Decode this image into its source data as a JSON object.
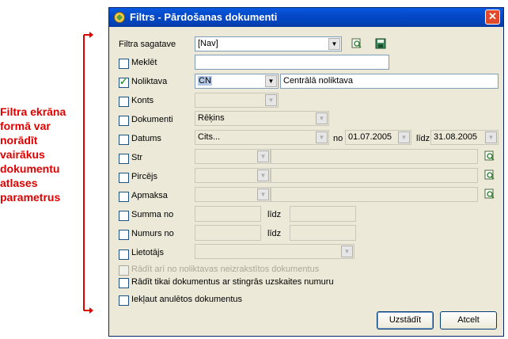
{
  "annotation": {
    "lines": [
      "Filtra ekrāna",
      "formā var",
      "norādīt",
      "vairākus",
      "dokumentu",
      "atlases",
      "parametrus"
    ],
    "color": "#e00000"
  },
  "window": {
    "title": "Filtrs - Pārdošanas dokumenti",
    "close_glyph": "✕"
  },
  "form": {
    "template": {
      "label": "Filtra sagatave",
      "value": "[Nav]"
    },
    "search": {
      "label": "Meklēt",
      "value": ""
    },
    "warehouse": {
      "label": "Noliktava",
      "checked": true,
      "code": "CN",
      "name": "Centrālā noliktava"
    },
    "account": {
      "label": "Konts",
      "value": ""
    },
    "documents": {
      "label": "Dokumenti",
      "value": "Rēķins"
    },
    "date": {
      "label": "Datums",
      "value": "Cits...",
      "from_label": "no",
      "from": "01.07.2005",
      "to_label": "līdz",
      "to": "31.08.2005"
    },
    "str": {
      "label": "Str"
    },
    "buyer": {
      "label": "Pircējs"
    },
    "payment": {
      "label": "Apmaksa"
    },
    "sum": {
      "label": "Summa no",
      "to_label": "līdz"
    },
    "number": {
      "label": "Numurs no",
      "to_label": "līdz"
    },
    "user": {
      "label": "Lietotājs"
    },
    "opt1": {
      "label": "Rādīt arī no noliktavas neizrakstītos dokumentus",
      "enabled": false
    },
    "opt2": {
      "label": "Rādīt tikai dokumentus ar stingrās uzskaites numuru"
    },
    "opt3": {
      "label": "Iekļaut anulētos dokumentus"
    }
  },
  "buttons": {
    "apply": "Uzstādīt",
    "cancel": "Atcelt"
  }
}
